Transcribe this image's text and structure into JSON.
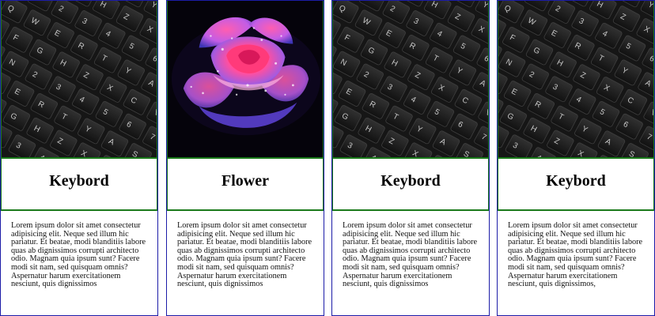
{
  "cards": [
    {
      "title": "Keybord",
      "image": "keyboard-photo",
      "text": "Lorem ipsum dolor sit amet consectetur adipisicing elit. Neque sed illum hic pariatur. Et beatae, modi blanditiis labore quas ab dignissimos corrupti architecto odio. Magnam quia ipsum sunt? Facere modi sit nam, sed quisquam omnis? Aspernatur harum exercitationem nesciunt, quis dignissimos"
    },
    {
      "title": "Flower",
      "image": "rose-photo",
      "text": "Lorem ipsum dolor sit amet consectetur adipisicing elit. Neque sed illum hic pariatur. Et beatae, modi blanditiis labore quas ab dignissimos corrupti architecto odio. Magnam quia ipsum sunt? Facere modi sit nam, sed quisquam omnis? Aspernatur harum exercitationem nesciunt, quis dignissimos"
    },
    {
      "title": "Keybord",
      "image": "keyboard-photo",
      "text": "Lorem ipsum dolor sit amet consectetur adipisicing elit. Neque sed illum hic pariatur. Et beatae, modi blanditiis labore quas ab dignissimos corrupti architecto odio. Magnam quia ipsum sunt? Facere modi sit nam, sed quisquam omnis? Aspernatur harum exercitationem nesciunt, quis dignissimos"
    },
    {
      "title": "Keybord",
      "image": "keyboard-photo",
      "text": "Lorem ipsum dolor sit amet consectetur adipisicing elit. Neque sed illum hic pariatur. Et beatae, modi blanditiis labore quas ab dignissimos corrupti architecto odio. Magnam quia ipsum sunt? Facere modi sit nam, sed quisquam omnis? Aspernatur harum exercitationem nesciunt, quis dignissimos,"
    }
  ],
  "keyboard_keys": [
    "Q",
    "W",
    "E",
    "R",
    "T",
    "Y",
    "A",
    "S",
    "D",
    "F",
    "G",
    "H",
    "Z",
    "X",
    "C",
    "V",
    "B",
    "N",
    "2",
    "3",
    "4",
    "5",
    "6",
    "7"
  ],
  "colors": {
    "card_border": "#1c1ca8",
    "section_border": "#1a7a1a",
    "keyboard_bg": "#1b1b1b",
    "rose_pink": "#ff3c8c",
    "rose_purple": "#6a4cd8"
  }
}
